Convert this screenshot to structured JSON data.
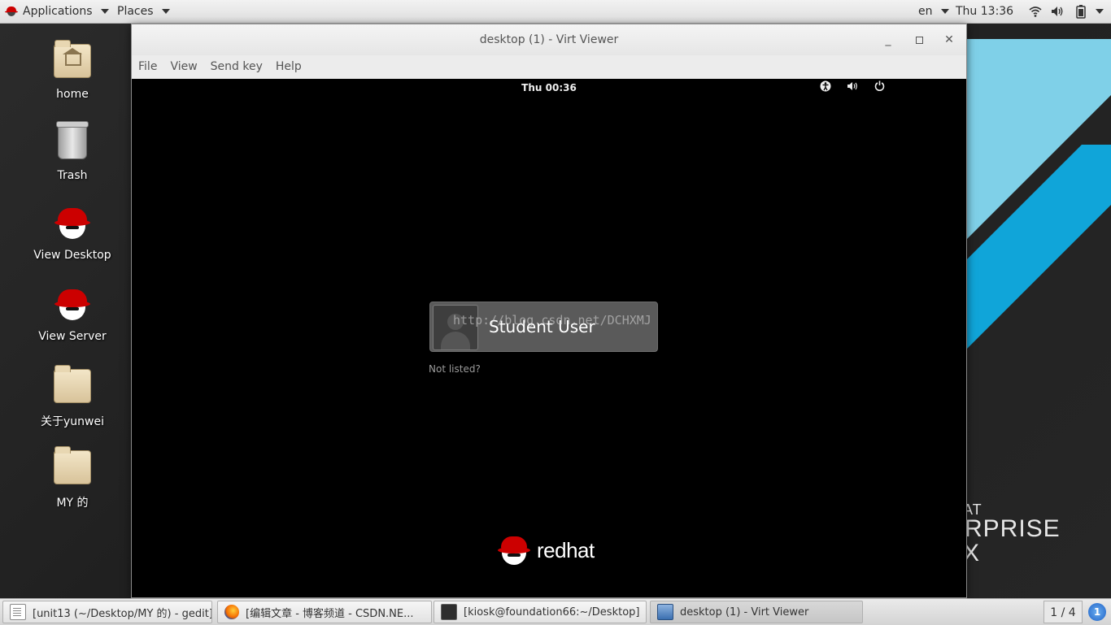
{
  "top_panel": {
    "applications": "Applications",
    "places": "Places",
    "language": "en",
    "clock": "Thu 13:36"
  },
  "desktop_icons": [
    {
      "label": "home"
    },
    {
      "label": "Trash"
    },
    {
      "label": "View Desktop"
    },
    {
      "label": "View Server"
    },
    {
      "label": "关于yunwei"
    },
    {
      "label": "MY 的"
    }
  ],
  "wallpaper": {
    "brand_lines": [
      "AT",
      "RPRISE",
      "X"
    ],
    "colors": {
      "light_stripe": "#7fd0e8",
      "blue_stripe": "#10a5d9"
    }
  },
  "window": {
    "title": "desktop (1) - Virt Viewer",
    "menu": [
      "File",
      "View",
      "Send key",
      "Help"
    ]
  },
  "guest": {
    "clock": "Thu 00:36",
    "user_name": "Student User",
    "watermark": "http://blog.csdn.net/DCHXMJ",
    "not_listed": "Not listed?",
    "logo_text": "redhat"
  },
  "taskbar": {
    "tasks": [
      {
        "label": "[unit13 (~/Desktop/MY 的) - gedit]",
        "icon": "gedit-icon"
      },
      {
        "label": "[编辑文章 - 博客频道 - CSDN.NE...",
        "icon": "firefox-icon"
      },
      {
        "label": "[kiosk@foundation66:~/Desktop]",
        "icon": "terminal-icon"
      },
      {
        "label": "desktop (1) - Virt Viewer",
        "icon": "virt-viewer-icon"
      }
    ],
    "workspace": "1 / 4",
    "notifications": "1"
  }
}
